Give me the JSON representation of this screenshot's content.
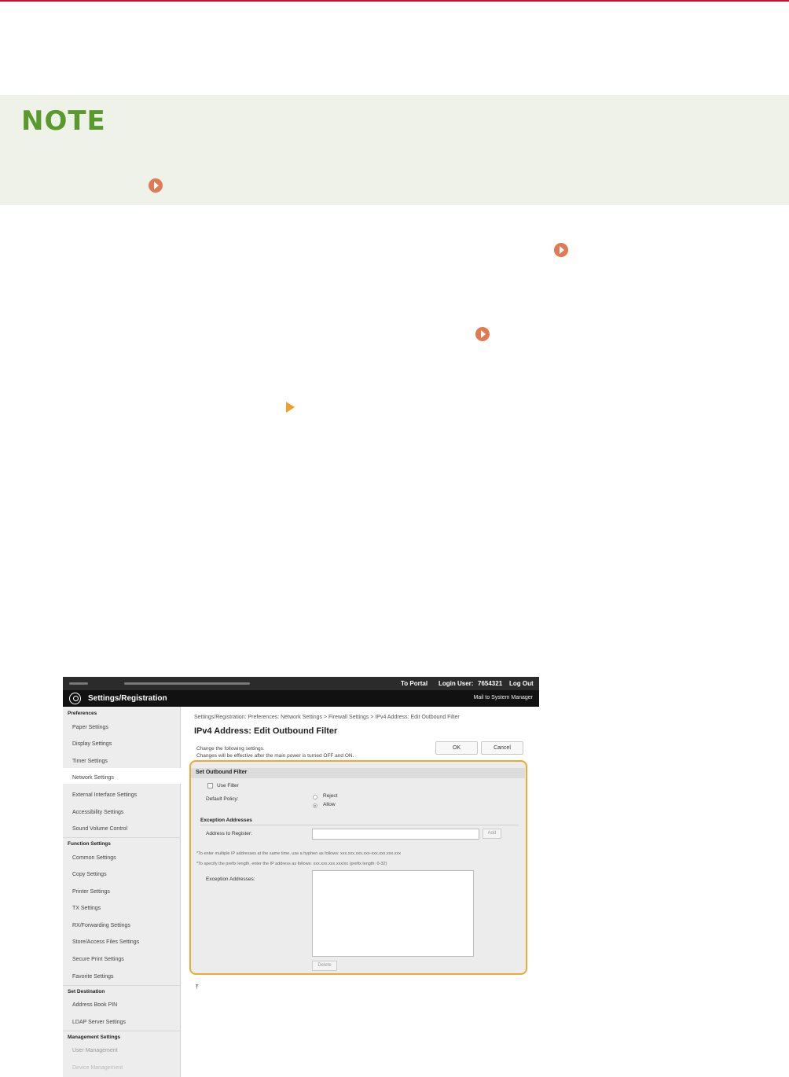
{
  "note": {
    "title": "NOTE"
  },
  "topbar": {
    "portal": "To Portal",
    "login_label": "Login User:",
    "login_user": "7654321",
    "logout": "Log Out"
  },
  "header": {
    "title": "Settings/Registration",
    "mail": "Mail to System Manager"
  },
  "sidebar": {
    "sections": [
      {
        "title": "Preferences",
        "items": [
          "Paper Settings",
          "Display Settings",
          "Timer Settings",
          "Network Settings",
          "External Interface Settings",
          "Accessibility Settings",
          "Sound Volume Control"
        ]
      },
      {
        "title": "Function Settings",
        "items": [
          "Common Settings",
          "Copy Settings",
          "Printer Settings",
          "TX Settings",
          "RX/Forwarding Settings",
          "Store/Access Files Settings",
          "Secure Print Settings",
          "Favorite Settings"
        ]
      },
      {
        "title": "Set Destination",
        "items": [
          "Address Book PIN",
          "LDAP Server Settings"
        ]
      },
      {
        "title": "Management Settings",
        "items": [
          "User Management",
          "Device Management"
        ]
      }
    ],
    "active": "Network Settings"
  },
  "main": {
    "breadcrumb": "Settings/Registration: Preferences: Network Settings > Firewall Settings > IPv4 Address: Edit Outbound Filter",
    "title": "IPv4 Address: Edit Outbound Filter",
    "info1": "Change the following settings.",
    "info2": "Changes will be effective after the main power is turned OFF and ON.",
    "ok": "OK",
    "cancel": "Cancel"
  },
  "panel": {
    "heading": "Set Outbound Filter",
    "use_filter": "Use Filter",
    "default_policy": "Default Policy:",
    "reject": "Reject",
    "allow": "Allow",
    "exception_heading": "Exception Addresses",
    "address_label": "Address to Register:",
    "add": "Add",
    "note1": "*To enter multiple IP addresses at the same time, use a hyphen as follows: xxx.xxx.xxx.xxx-xxx.xxx.xxx.xxx",
    "note2": "*To specify the prefix length, enter the IP address as follows: xxx.xxx.xxx.xxx/xx (prefix length: 0-32)",
    "exception_list_label": "Exception Addresses:",
    "delete": "Delete"
  },
  "colors": {
    "accent": "#f0a830",
    "note_title": "#5a9a2c",
    "link_arrow": "#e07a52",
    "step_arrow": "#f0a02a",
    "top_rule": "#c8102e"
  },
  "icons": [
    "link-arrow-icon",
    "step-arrow-icon",
    "app-logo-icon",
    "back-to-top-icon"
  ]
}
